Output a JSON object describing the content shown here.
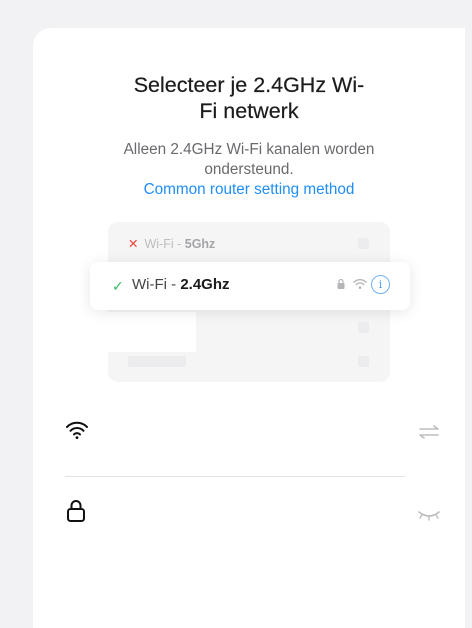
{
  "page": {
    "title_line1": "Selecteer je 2.4GHz Wi-",
    "title_line2": "Fi netwerk",
    "subtitle_line1": "Alleen 2.4GHz Wi-Fi kanalen worden",
    "subtitle_prefix": "ondersteund. ",
    "subtitle_link": "Common router setting method"
  },
  "illustration": {
    "bad_network_prefix": "Wi-Fi - ",
    "bad_network_band": "5Ghz",
    "good_network_prefix": "Wi-Fi - ",
    "good_network_band": "2.4Ghz",
    "bad_marker_icon": "cross-icon",
    "good_marker_icon": "check-icon"
  },
  "form": {
    "wifi_field": {
      "lead_icon": "wifi-icon",
      "trail_icon": "switch-network-icon"
    },
    "password_field": {
      "lead_icon": "lock-icon",
      "trail_icon": "eye-closed-icon"
    }
  },
  "colors": {
    "accent": "#1f8ef5",
    "success": "#2cbf5c",
    "error": "#f0413a",
    "text": "#1c1c1e",
    "muted": "#6a6a6e"
  }
}
